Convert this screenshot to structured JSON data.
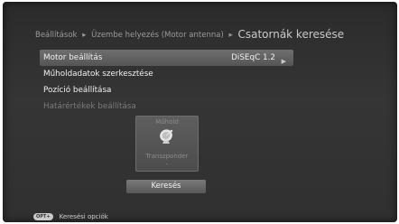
{
  "breadcrumb": {
    "part1": "Beállítások",
    "part2": "Üzembe helyezés (Motor antenna)",
    "current": "Csatornák keresése",
    "separator": "▸"
  },
  "menu": {
    "items": [
      {
        "label": "Motor beállítás",
        "value": "DiSEqC 1.2",
        "selected": true,
        "enabled": true
      },
      {
        "label": "Műholdadatok szerkesztése",
        "selected": false,
        "enabled": true
      },
      {
        "label": "Pozíció beállítása",
        "selected": false,
        "enabled": true
      },
      {
        "label": "Határértékek beállítása",
        "selected": false,
        "enabled": false
      }
    ]
  },
  "satellite_panel": {
    "satellite_label": "Műhold",
    "transponder_label": "Transzponder",
    "transponder_value": "-"
  },
  "search_button": {
    "label": "Keresés"
  },
  "footer": {
    "badge": "OPT+",
    "text": "Keresési opciók"
  },
  "colors": {
    "background": "#303030",
    "selected": "#626262",
    "disabled_text": "#7b7b7b"
  }
}
